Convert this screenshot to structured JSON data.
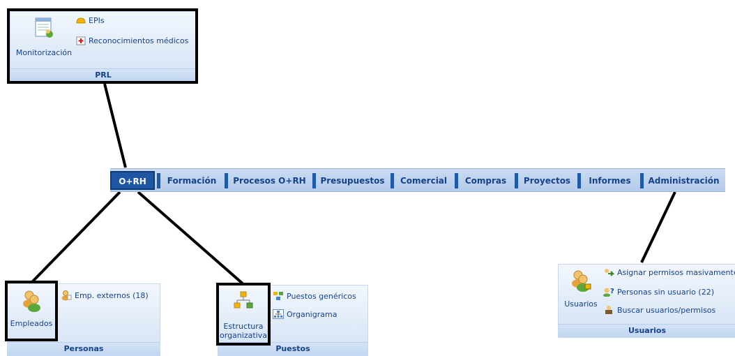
{
  "tabs": [
    "O+RH",
    "Formación",
    "Procesos O+RH",
    "Presupuestos",
    "Comercial",
    "Compras",
    "Proyectos",
    "Informes",
    "Administración"
  ],
  "prl": {
    "monitorizacion": "Monitorización",
    "epis": "EPIs",
    "reconocimientos": "Reconocimientos médicos",
    "label": "PRL"
  },
  "personas": {
    "empleados": "Empleados",
    "externos": "Emp. externos (18)",
    "label": "Personas"
  },
  "puestos": {
    "estructura_1": "Estructura",
    "estructura_2": "organizativa",
    "genericos": "Puestos genéricos",
    "organigrama": "Organigrama",
    "label": "Puestos"
  },
  "usuarios": {
    "usuarios": "Usuarios",
    "asignar": "Asignar permisos masivamente",
    "sin_usuario": "Personas sin usuario (22)",
    "buscar": "Buscar usuarios/permisos",
    "label": "Usuarios"
  }
}
